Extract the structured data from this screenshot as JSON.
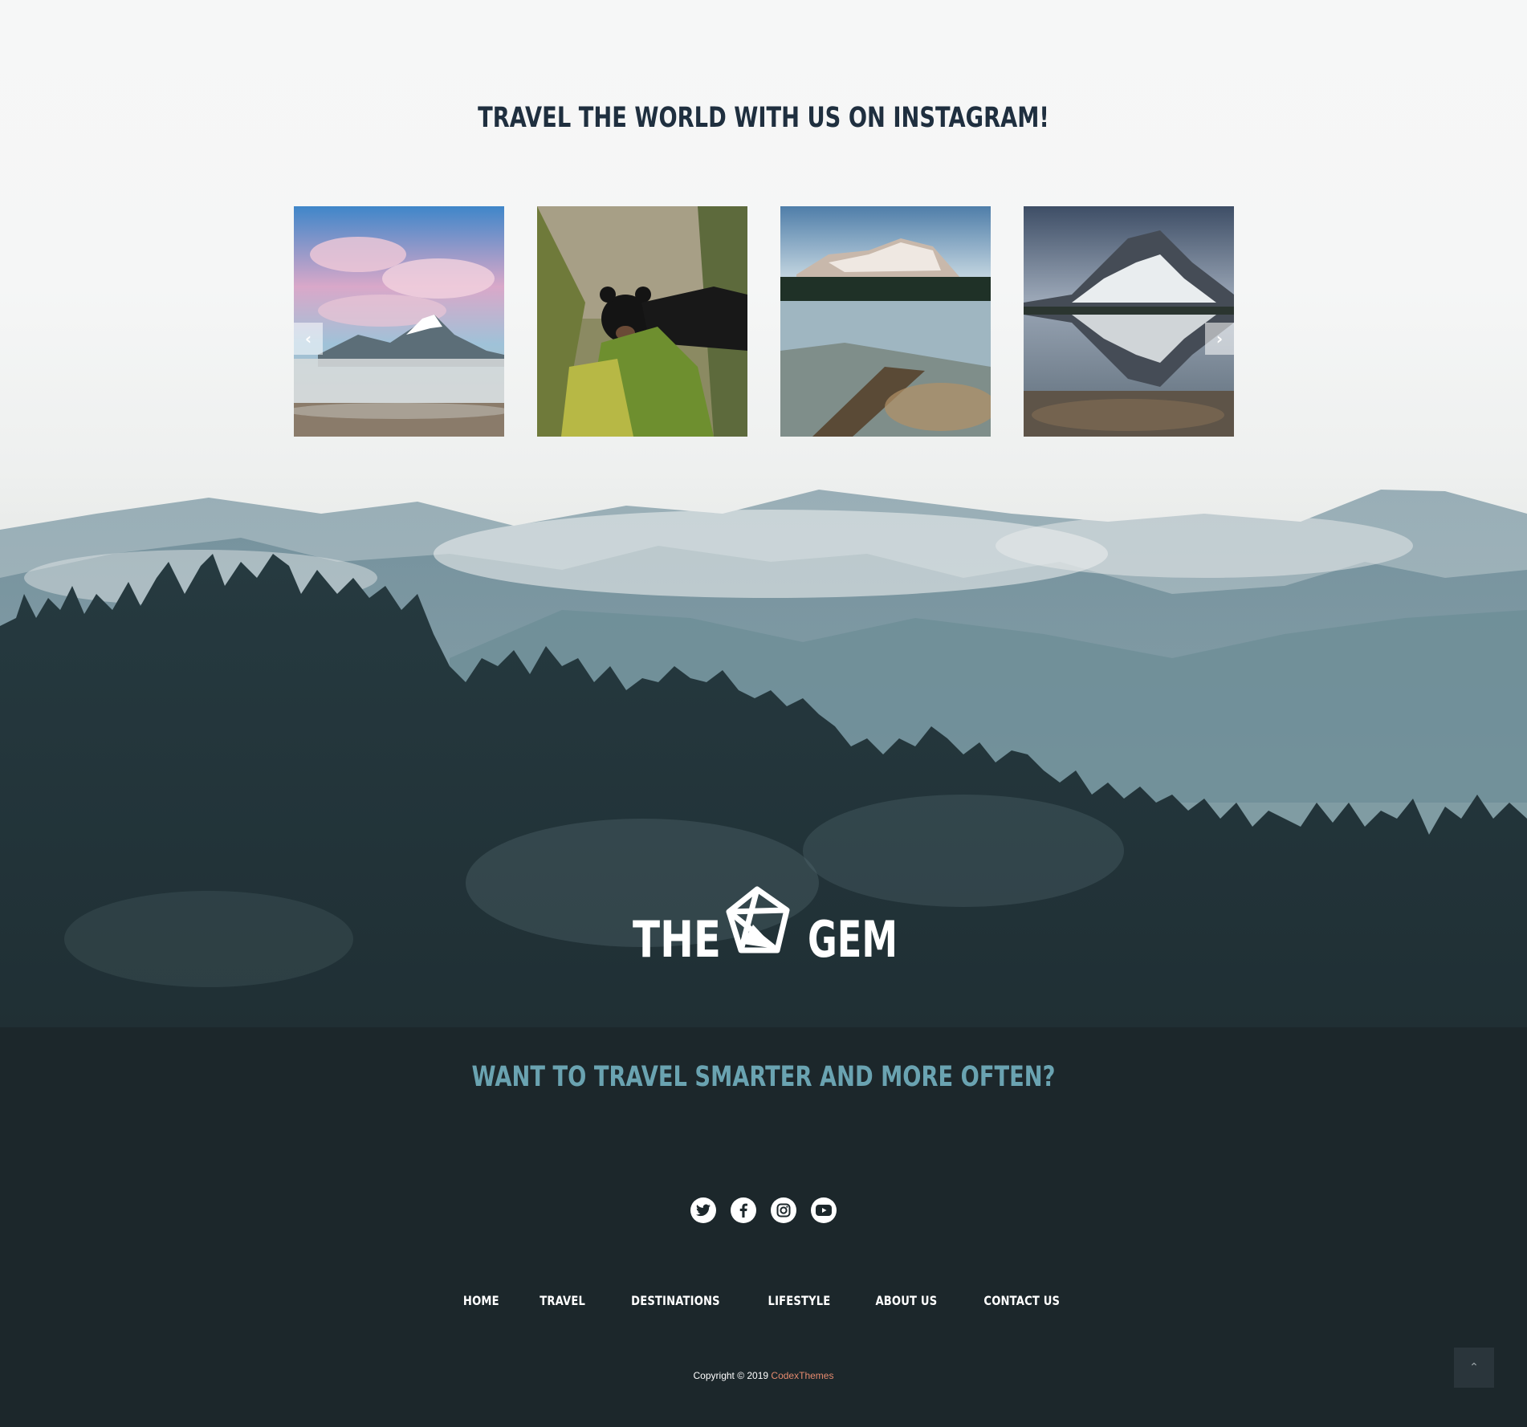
{
  "section": {
    "title": "TRAVEL THE WORLD WITH US ON INSTAGRAM!"
  },
  "gallery": {
    "prev_label": "‹",
    "next_label": "›",
    "items": [
      {
        "name": "pink clouds over misty mountain lake"
      },
      {
        "name": "black bear in forest"
      },
      {
        "name": "snowy mountain and frozen lake"
      },
      {
        "name": "snowy peak reflected in lake"
      }
    ]
  },
  "footer": {
    "logo_left": "THE",
    "logo_right": "GEM",
    "tagline": "WANT TO TRAVEL SMARTER AND MORE OFTEN?",
    "social": [
      "twitter",
      "facebook",
      "instagram",
      "youtube"
    ],
    "nav": {
      "home": "HOME",
      "travel": "TRAVEL",
      "destinations": "DESTINATIONS",
      "lifestyle": "LIFESTYLE",
      "about": "ABOUT US",
      "contact": "CONTACT US"
    },
    "copyright_text": "Copyright © 2019",
    "copyright_brand": "CodexThemes",
    "scroll_top": "⌃"
  },
  "colors": {
    "title": "#1f2f3f",
    "tagline": "#6aa3b1",
    "footer_bg": "#1c272b",
    "brand_link": "#e58a6e"
  }
}
